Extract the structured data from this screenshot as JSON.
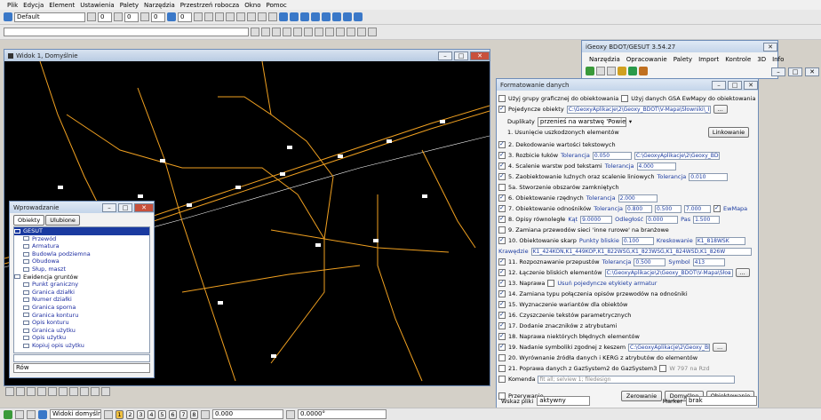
{
  "menu": [
    "Plik",
    "Edycja",
    "Element",
    "Ustawienia",
    "Palety",
    "Narzędzia",
    "Przestrzeń robocza",
    "Okno",
    "Pomoc"
  ],
  "toolbar1": {
    "style_value": "Default",
    "lineweight_values": [
      "0",
      "0",
      "0",
      "0"
    ]
  },
  "view_window": {
    "title": "Widok 1, Domyślnie",
    "background": "#000000",
    "line_color": "#f0a020"
  },
  "entry_window": {
    "title": "Wprowadzanie",
    "tabs": [
      "Obiekty",
      "Ulubione"
    ],
    "items": [
      "GESUT",
      "Przewód",
      "Armatura",
      "Budowla podziemna",
      "Obudowa",
      "Słup, maszt",
      "Ewidencja gruntów",
      "Punkt graniczny",
      "Granica działki",
      "Numer działki",
      "Granica sporna",
      "Granica konturu",
      "Opis konturu",
      "Granica użytku",
      "Opis użytku",
      "Kopiuj opis użytku"
    ],
    "bottom_select": "Rów"
  },
  "igeoxy": {
    "title": "iGeoxy BDOT/GESUT 3.54.27",
    "menu": [
      "Narzędzia",
      "Opracowanie",
      "Palety",
      "Import",
      "Kontrole",
      "3D",
      "Info"
    ]
  },
  "fmt": {
    "title": "Formatowanie danych",
    "top_option1": "Użyj grupy graficznej do obiektowania",
    "top_option2": "Użyj danych GSA EwMapy do obiektowania",
    "single_objects": "Pojedyncze obiekty",
    "single_path": "C:\\GeoxyAplikacje\\2\\Geoxy_BDOT\\V-Mapa\\Słowniki\\_Impor",
    "duplicates_label": "Duplikaty",
    "duplicates_value": "przenieś na warstwę 'Powielone'",
    "step1": "1. Usunięcie uszkodzonych elementów",
    "linking_btn": "Linkowanie",
    "step2": "2. Dekodowanie wartości tekstowych",
    "step3": "3. Rozbicie łuków",
    "tol3": "Tolerancja",
    "tol3_val": "0.050",
    "path3": "C:\\GeoxyAplikacje\\2\\Geoxy_BDOT\\",
    "step4": "4. Scalenie warstw pod tekstami",
    "tol4": "Tolerancja",
    "tol4_val": "4.000",
    "step5": "5. Zaobiektowanie luźnych oraz scalenie liniowych",
    "tol5": "Tolerancja",
    "tol5_val": "0.010",
    "step5a": "5a. Stworzenie obszarów zamkniętych",
    "step6": "6. Obiektowanie rzędnych",
    "tol6": "Tolerancja",
    "tol6_val": "2.000",
    "step7": "7. Obiektowanie odnośników",
    "tol7": "Tolerancja",
    "tol7_vals": [
      "0.800",
      "0.500",
      "7.000"
    ],
    "ewmapa": "EwMapa",
    "step8": "8. Opisy równoległe",
    "kat": "Kąt",
    "kat_val": "9.0000",
    "odl": "Odległość",
    "odl_val": "0.000",
    "pas": "Pas",
    "pas_val": "1.500",
    "step9": "9. Zamiana przewodów sieci 'inne rurowe' na branżowe",
    "step10": "10. Obiektowanie skarp",
    "pkt": "Punkty bliskie",
    "pkt_val": "0.100",
    "kresk": "Kreskowanie",
    "kresk_val": "K1_818WSK",
    "krawedzie": "Krawędzie",
    "kraw_val": "K1_424KON,K1_449KOP,K1_822WSG,K1_823WSG,K1_824WSD,K1_826W",
    "step11": "11. Rozpoznawanie przepustów",
    "tol11": "Tolerancja",
    "tol11_val": "0.500",
    "symbol": "Symbol",
    "symbol_val": "413",
    "step12": "12. Łączenie bliskich elementów",
    "path12": "C:\\GeoxyAplikacje\\2\\Geoxy_BDOT\\V-Mapa\\Słов",
    "step13": "13. Naprawa",
    "step13b": "Usuń pojedyncze etykiety armatur",
    "step14": "14. Zamiana typu połączenia opisów przewodów na odnośniki",
    "step15": "15. Wyznaczenie wariantów dla obiektów",
    "step16": "16. Czyszczenie tekstów parametrycznych",
    "step17": "17. Dodanie znaczników z atrybutami",
    "step18": "18. Naprawa niektórych błędnych elementów",
    "step19": "19. Nadanie symboliki zgodnej z keszem",
    "path19": "C:\\GeoxyAplikacje\\2\\Geoxy_BDOT\\V-N",
    "step20": "20. Wyrównanie źródła danych i KERG z atrybutów do elementów",
    "step21": "21. Poprawa danych z GazSystem2 do GazSystem3",
    "w797": "W 797 na Rzd",
    "komenda": "Komenda",
    "komenda_val": "fit all; selview 1; filedesign",
    "przerywanie": "Przerywanie",
    "btn_zerowanie": "Zerowanie",
    "btn_domyslne": "Domyślne",
    "btn_obiektowanie": "Obiektowanie",
    "wskaz": "Wskaz pliki",
    "wskaz_val": "aktywny",
    "marker": "Marker",
    "marker_val": "brak"
  },
  "statusbar": {
    "views_label": "Widoki domyślne",
    "pages": [
      "1",
      "2",
      "3",
      "4",
      "5",
      "6",
      "7",
      "8"
    ],
    "coord1": "0.000",
    "coord2": "0.0000°"
  }
}
